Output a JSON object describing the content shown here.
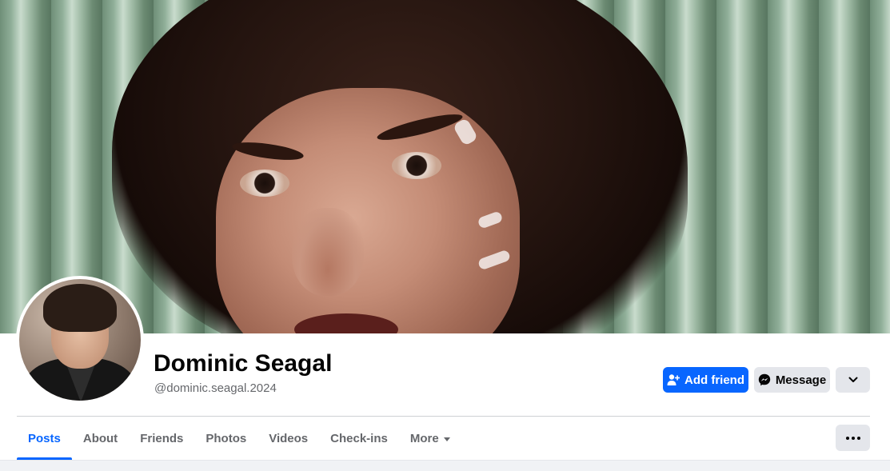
{
  "profile": {
    "name": "Dominic Seagal",
    "handle": "@dominic.seagal.2024"
  },
  "actions": {
    "add_friend_label": "Add friend",
    "add_friend_icon": "user-plus-icon",
    "message_label": "Message",
    "message_icon": "messenger-icon",
    "more_options_icon": "chevron-down-icon"
  },
  "tabs": [
    {
      "label": "Posts",
      "active": true
    },
    {
      "label": "About",
      "active": false
    },
    {
      "label": "Friends",
      "active": false
    },
    {
      "label": "Photos",
      "active": false
    },
    {
      "label": "Videos",
      "active": false
    },
    {
      "label": "Check-ins",
      "active": false
    },
    {
      "label": "More",
      "active": false,
      "has_dropdown": true
    }
  ],
  "tab_overflow_icon": "ellipsis-icon",
  "colors": {
    "accent": "#0866ff",
    "secondary_button": "#e4e6eb",
    "muted_text": "#65676b",
    "page_background": "#f0f2f5"
  }
}
